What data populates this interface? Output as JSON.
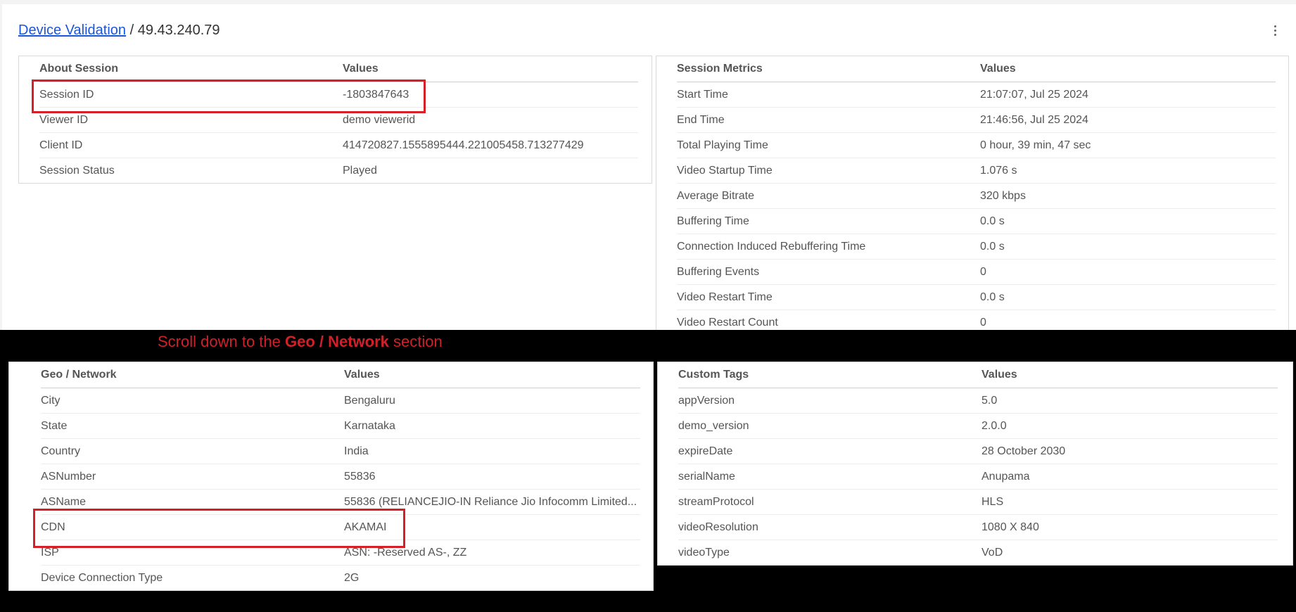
{
  "breadcrumb": {
    "link": "Device Validation",
    "separator": " / ",
    "current": "49.43.240.79"
  },
  "menu_icon": "vertical-ellipsis-icon",
  "about_session": {
    "header": [
      "About Session",
      "Values"
    ],
    "rows": [
      [
        "Session ID",
        "-1803847643"
      ],
      [
        "Viewer ID",
        "demo viewerid"
      ],
      [
        "Client ID",
        "414720827.1555895444.221005458.713277429"
      ],
      [
        "Session Status",
        "Played"
      ]
    ]
  },
  "session_metrics": {
    "header": [
      "Session Metrics",
      "Values"
    ],
    "rows": [
      [
        "Start Time",
        "21:07:07, Jul 25 2024"
      ],
      [
        "End Time",
        "21:46:56, Jul 25 2024"
      ],
      [
        "Total Playing Time",
        "0 hour, 39 min, 47 sec"
      ],
      [
        "Video Startup Time",
        "1.076 s"
      ],
      [
        "Average Bitrate",
        "320 kbps"
      ],
      [
        "Buffering Time",
        "0.0 s"
      ],
      [
        "Connection Induced Rebuffering Time",
        "0.0 s"
      ],
      [
        "Buffering Events",
        "0"
      ],
      [
        "Video Restart Time",
        "0.0 s"
      ],
      [
        "Video Restart Count",
        "0"
      ]
    ]
  },
  "instruction": {
    "prefix": "Scroll down to the ",
    "bold": "Geo / Network",
    "suffix": " section"
  },
  "geo_network": {
    "header": [
      "Geo / Network",
      "Values"
    ],
    "rows": [
      [
        "City",
        "Bengaluru"
      ],
      [
        "State",
        "Karnataka"
      ],
      [
        "Country",
        "India"
      ],
      [
        "ASNumber",
        "55836"
      ],
      [
        "ASName",
        "55836 (RELIANCEJIO-IN Reliance Jio Infocomm Limited..."
      ],
      [
        "CDN",
        "AKAMAI"
      ],
      [
        "ISP",
        "ASN: -Reserved AS-, ZZ"
      ],
      [
        "Device Connection Type",
        "2G"
      ]
    ]
  },
  "custom_tags": {
    "header": [
      "Custom Tags",
      "Values"
    ],
    "rows": [
      [
        "appVersion",
        "5.0"
      ],
      [
        "demo_version",
        "2.0.0"
      ],
      [
        "expireDate",
        "28 October 2030"
      ],
      [
        "serialName",
        "Anupama"
      ],
      [
        "streamProtocol",
        "HLS"
      ],
      [
        "videoResolution",
        "1080 X 840"
      ],
      [
        "videoType",
        "VoD"
      ]
    ]
  },
  "colors": {
    "link": "#1a56db",
    "highlight": "#d61f26",
    "instruction": "#d0202a",
    "band": "#000000"
  }
}
